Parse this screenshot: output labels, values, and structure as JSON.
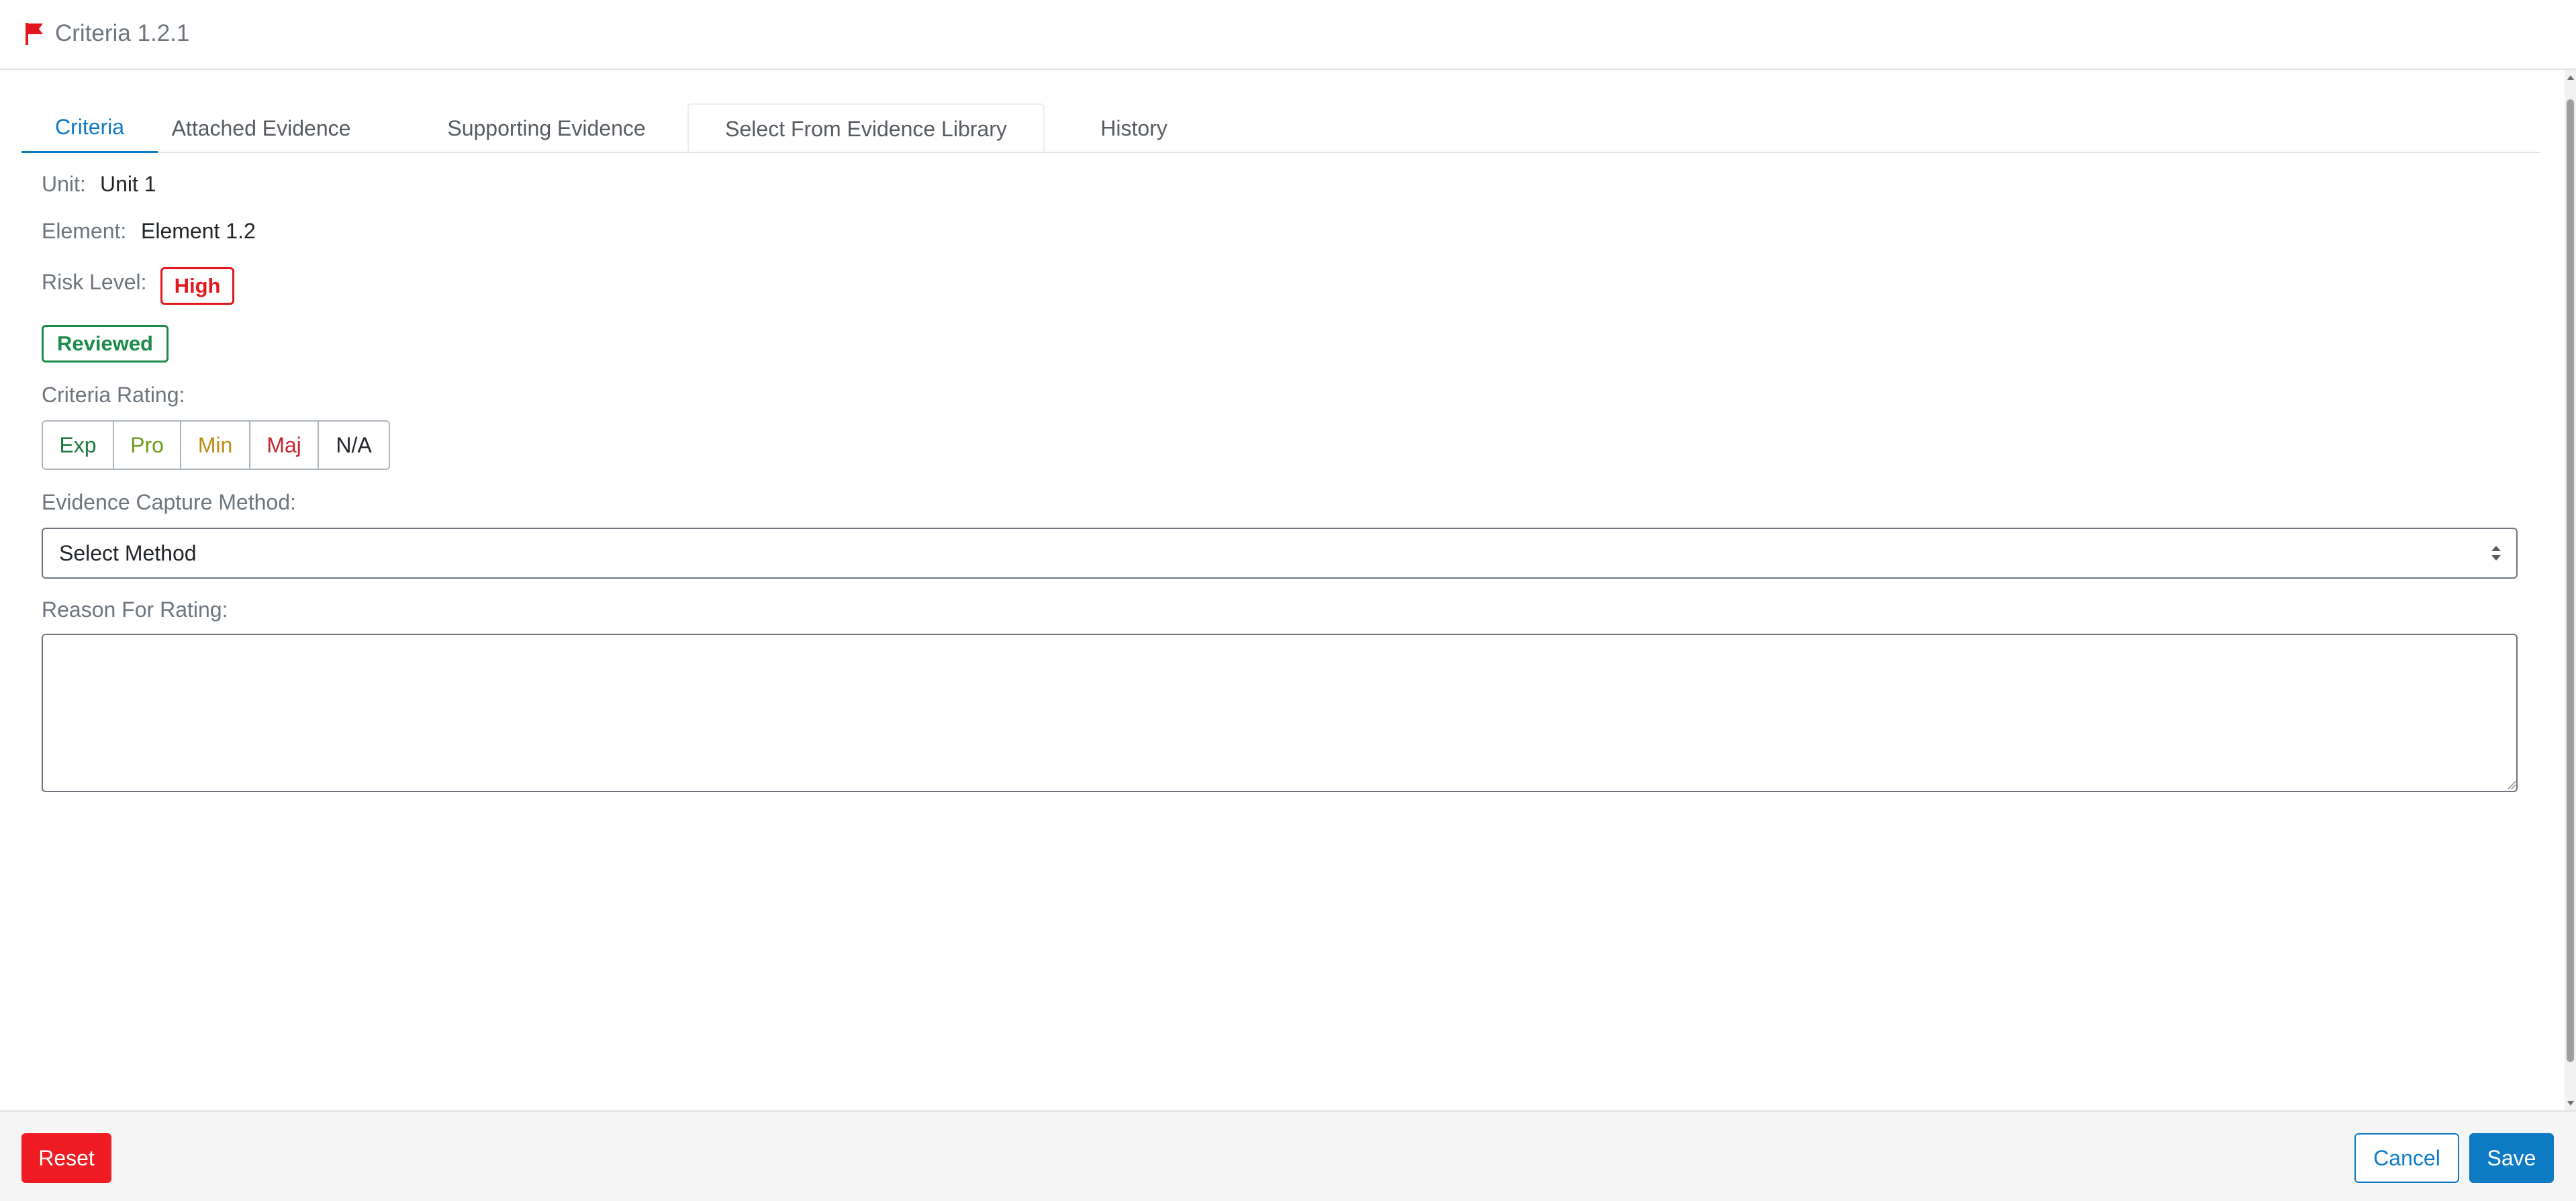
{
  "header": {
    "title": "Criteria 1.2.1",
    "icon": "flag-icon",
    "icon_color": "#e4151d"
  },
  "tabs": [
    {
      "label": "Criteria",
      "active": true
    },
    {
      "label": "Attached Evidence",
      "active": false
    },
    {
      "label": "Supporting Evidence",
      "active": false
    },
    {
      "label": "Select From Evidence Library",
      "active": false
    },
    {
      "label": "History",
      "active": false
    }
  ],
  "fields": {
    "unit_label": "Unit:",
    "unit_value": "Unit 1",
    "element_label": "Element:",
    "element_value": "Element 1.2",
    "risk_label": "Risk Level:",
    "risk_value": "High",
    "review_status": "Reviewed",
    "rating_label": "Criteria Rating:",
    "ratings": [
      {
        "label": "Exp",
        "color": "#1b7a3d"
      },
      {
        "label": "Pro",
        "color": "#6a9a1a"
      },
      {
        "label": "Min",
        "color": "#c08a12"
      },
      {
        "label": "Maj",
        "color": "#c4262e"
      },
      {
        "label": "N/A",
        "color": "#212529"
      }
    ],
    "method_label": "Evidence Capture Method:",
    "method_value": "Select Method",
    "reason_label": "Reason For Rating:",
    "reason_value": ""
  },
  "footer": {
    "reset_label": "Reset",
    "cancel_label": "Cancel",
    "save_label": "Save"
  },
  "colors": {
    "accent": "#0d7bc4",
    "danger": "#ef1c24",
    "success": "#1b8a4a"
  }
}
